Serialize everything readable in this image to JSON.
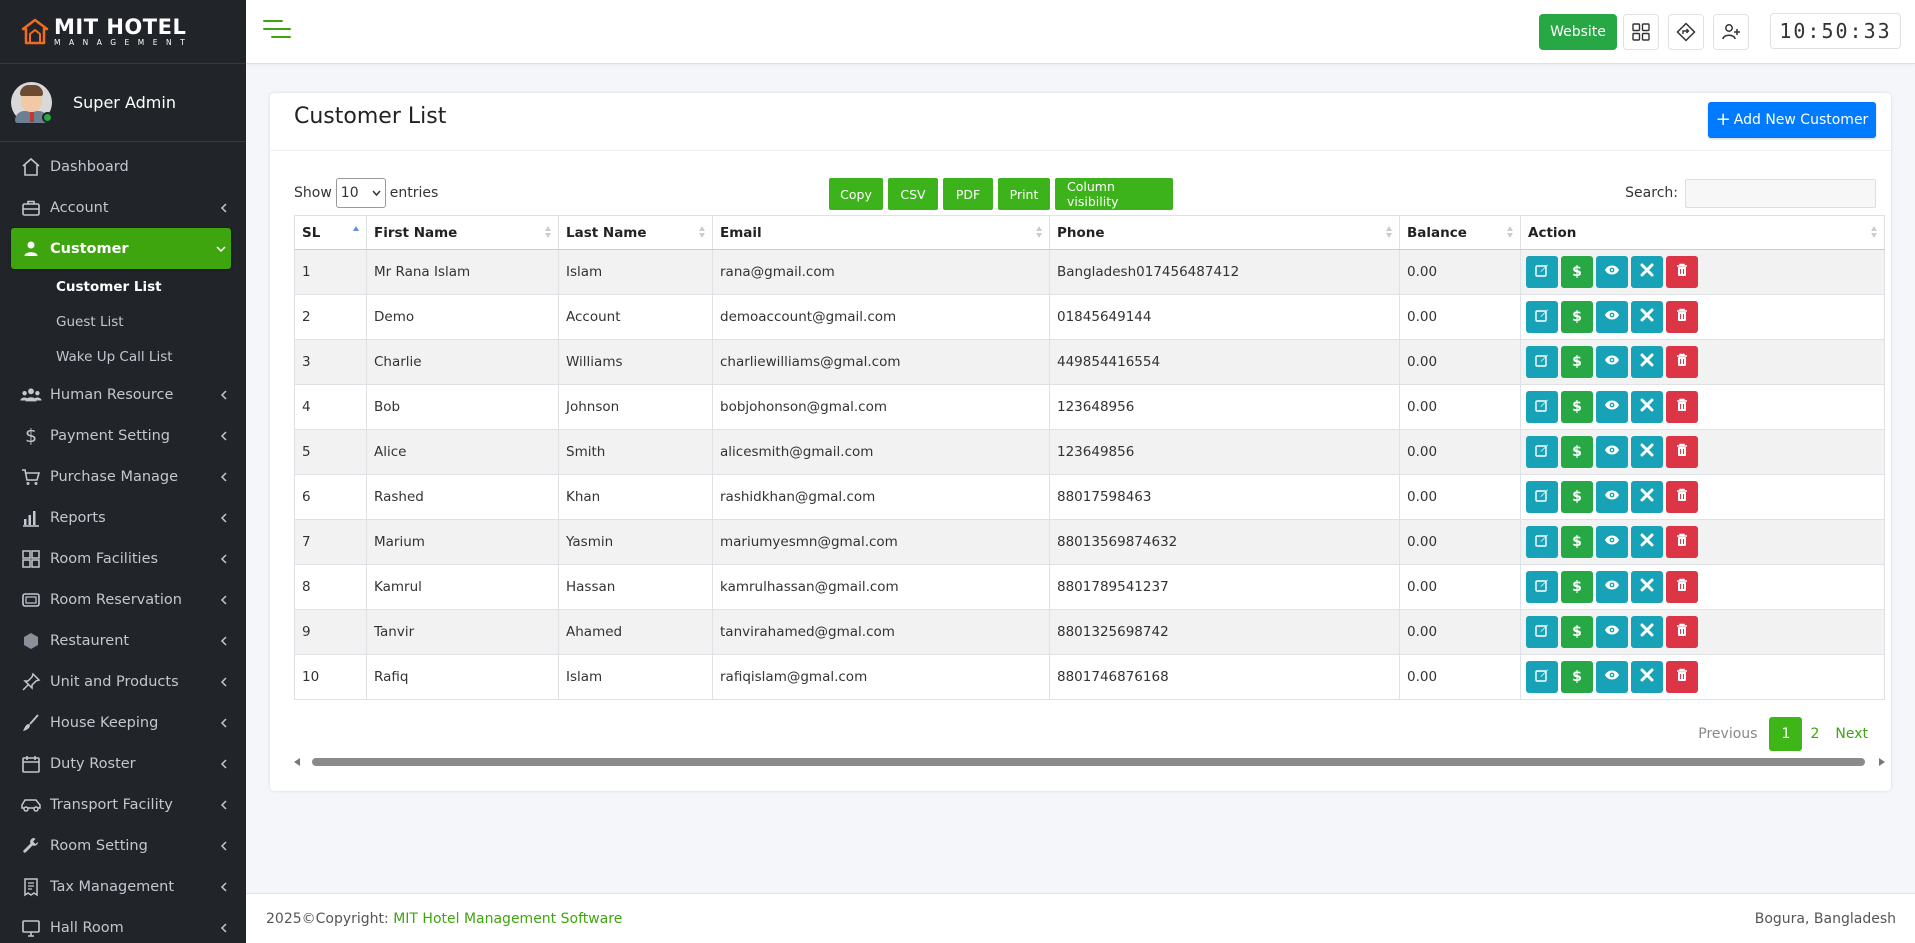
{
  "brand": {
    "title": "MIT HOTEL",
    "subtitle": "MANAGEMENT"
  },
  "user": {
    "name": "Super Admin"
  },
  "sidebar": {
    "items": [
      {
        "label": "Dashboard",
        "icon": "home-icon"
      },
      {
        "label": "Account",
        "icon": "briefcase-icon"
      },
      {
        "label": "Customer",
        "icon": "user-icon"
      },
      {
        "label": "Human Resource",
        "icon": "users-icon"
      },
      {
        "label": "Payment Setting",
        "icon": "dollar-icon"
      },
      {
        "label": "Purchase Manage",
        "icon": "cart-icon"
      },
      {
        "label": "Reports",
        "icon": "bar-chart-icon"
      },
      {
        "label": "Room Facilities",
        "icon": "grid-icon"
      },
      {
        "label": "Room Reservation",
        "icon": "tv-icon"
      },
      {
        "label": "Restaurent",
        "icon": "cube-icon"
      },
      {
        "label": "Unit and Products",
        "icon": "pin-icon"
      },
      {
        "label": "House Keeping",
        "icon": "brush-icon"
      },
      {
        "label": "Duty Roster",
        "icon": "calendar-icon"
      },
      {
        "label": "Transport Facility",
        "icon": "car-icon"
      },
      {
        "label": "Room Setting",
        "icon": "wrench-icon"
      },
      {
        "label": "Tax Management",
        "icon": "receipt-icon"
      },
      {
        "label": "Hall Room",
        "icon": "monitor-icon"
      }
    ],
    "customer_sub": [
      "Customer List",
      "Guest List",
      "Wake Up Call List"
    ]
  },
  "topbar": {
    "website_label": "Website",
    "clock": "10:50:33"
  },
  "page": {
    "title": "Customer List",
    "add_button": "Add New Customer",
    "show_label": "Show",
    "entries_label": "entries",
    "length_value": "10",
    "search_label": "Search:",
    "search_value": "",
    "export_buttons": [
      "Copy",
      "CSV",
      "PDF",
      "Print",
      "Column visibility"
    ]
  },
  "table": {
    "columns": [
      "SL",
      "First Name",
      "Last Name",
      "Email",
      "Phone",
      "Balance",
      "Action"
    ],
    "rows": [
      [
        "1",
        "Mr Rana Islam",
        "Islam",
        "rana@gmail.com",
        "Bangladesh017456487412",
        "0.00"
      ],
      [
        "2",
        "Demo",
        "Account",
        "demoaccount@gmail.com",
        "01845649144",
        "0.00"
      ],
      [
        "3",
        "Charlie",
        "Williams",
        "charliewilliams@gmal.com",
        "449854416554",
        "0.00"
      ],
      [
        "4",
        "Bob",
        "Johnson",
        "bobjohonson@gmal.com",
        "123648956",
        "0.00"
      ],
      [
        "5",
        "Alice",
        "Smith",
        "alicesmith@gmail.com",
        "123649856",
        "0.00"
      ],
      [
        "6",
        "Rashed",
        "Khan",
        "rashidkhan@gmal.com",
        "88017598463",
        "0.00"
      ],
      [
        "7",
        "Marium",
        "Yasmin",
        "mariumyesmn@gmal.com",
        "88013569874632",
        "0.00"
      ],
      [
        "8",
        "Kamrul",
        "Hassan",
        "kamrulhassan@gmail.com",
        "8801789541237",
        "0.00"
      ],
      [
        "9",
        "Tanvir",
        "Ahamed",
        "tanvirahamed@gmal.com",
        "8801325698742",
        "0.00"
      ],
      [
        "10",
        "Rafiq",
        "Islam",
        "rafiqislam@gmal.com",
        "8801746876168",
        "0.00"
      ]
    ]
  },
  "pagination": {
    "previous": "Previous",
    "pages": [
      "1",
      "2"
    ],
    "current": "1",
    "next": "Next"
  },
  "footer": {
    "copyright_prefix": "2025©Copyright: ",
    "copyright_link": "MIT Hotel Management Software",
    "location": "Bogura, Bangladesh"
  },
  "colors": {
    "accent_green": "#3fa50f",
    "primary_blue": "#007bff",
    "info": "#17a2b8",
    "success": "#28a745",
    "danger": "#dc3545",
    "sidebar_bg": "#212529"
  }
}
